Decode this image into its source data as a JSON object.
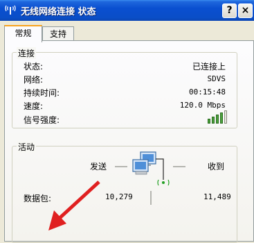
{
  "window": {
    "title": "无线网络连接 状态",
    "help_button": "?",
    "close_button": "×"
  },
  "tabs": [
    {
      "label": "常规",
      "active": true
    },
    {
      "label": "支持",
      "active": false
    }
  ],
  "connection": {
    "group_title": "连接",
    "rows": [
      {
        "label": "状态:",
        "value": "已连接上"
      },
      {
        "label": "网络:",
        "value": "SDVS"
      },
      {
        "label": "持续时间:",
        "value": "00:15:48"
      },
      {
        "label": "速度:",
        "value": "120.0 Mbps"
      },
      {
        "label": "信号强度:",
        "value": ""
      }
    ],
    "signal_strength_bars": 4,
    "signal_strength_max": 5
  },
  "activity": {
    "group_title": "活动",
    "sent_label": "发送",
    "received_label": "收到",
    "packets_label": "数据包:",
    "packets_sent": "10,279",
    "packets_received": "11,489"
  },
  "colors": {
    "title_bar": "#0a4fd0",
    "tab_highlight": "#f8a31d",
    "signal": "#4aa03a",
    "annotation_arrow": "#e02020"
  }
}
